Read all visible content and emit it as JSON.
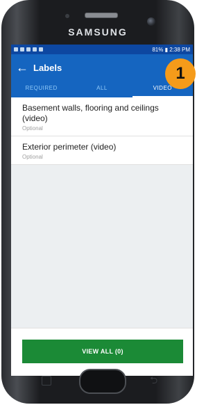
{
  "device": {
    "brand": "SAMSUNG"
  },
  "status_bar": {
    "right_text": "81% ▮ 2:38 PM"
  },
  "app_bar": {
    "title": "Labels"
  },
  "tabs": [
    {
      "label": "REQUIRED",
      "active": false
    },
    {
      "label": "ALL",
      "active": false
    },
    {
      "label": "VIDEO",
      "active": true
    }
  ],
  "list": {
    "items": [
      {
        "title": "Basement walls, flooring and ceilings (video)",
        "subtitle": "Optional"
      },
      {
        "title": "Exterior perimeter (video)",
        "subtitle": "Optional"
      }
    ]
  },
  "footer": {
    "button_label": "VIEW ALL (0)"
  },
  "annotation": {
    "badge": "1"
  },
  "colors": {
    "status_bar": "#0d47a1",
    "app_bar": "#1565c0",
    "button": "#1b8a36",
    "badge": "#f59b1a"
  }
}
